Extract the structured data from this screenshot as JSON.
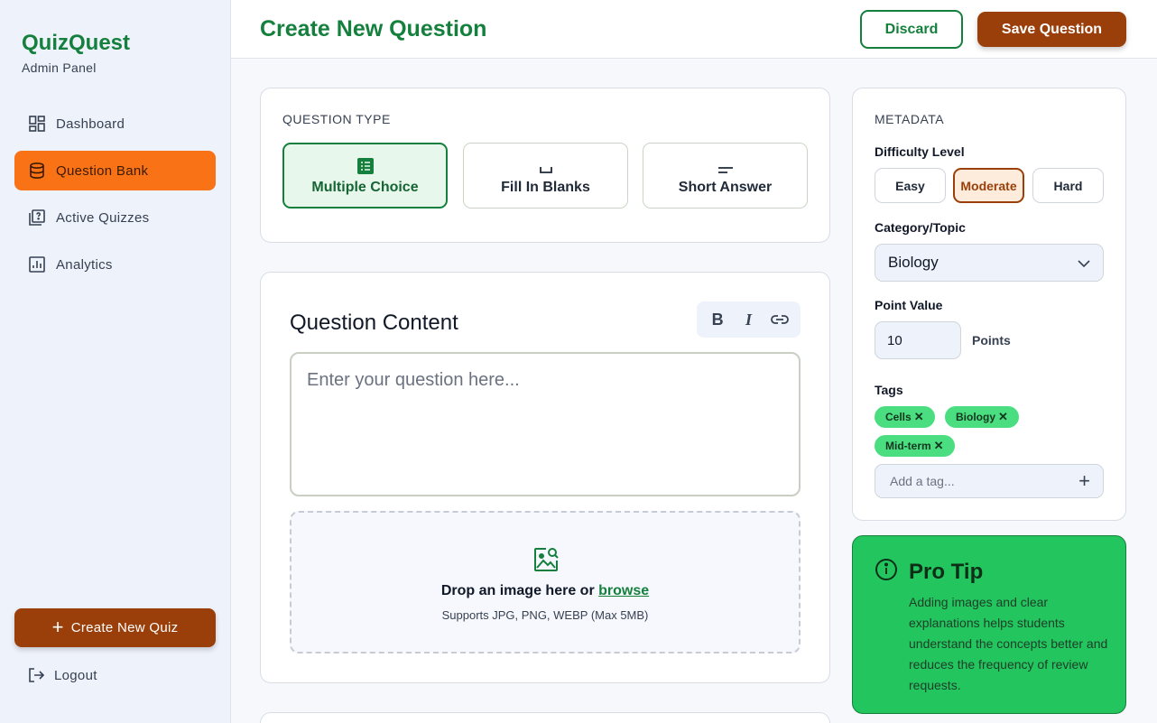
{
  "sidebar": {
    "brand": "QuizQuest",
    "subtitle": "Admin Panel",
    "items": [
      {
        "label": "Dashboard",
        "icon": "dashboard-grid-icon"
      },
      {
        "label": "Question Bank",
        "icon": "database-icon"
      },
      {
        "label": "Active Quizzes",
        "icon": "quiz-icon"
      },
      {
        "label": "Analytics",
        "icon": "bar-chart-icon"
      }
    ],
    "active_index": 1,
    "create_quiz_label": "Create New Quiz",
    "logout_label": "Logout"
  },
  "header": {
    "title": "Create New Question",
    "discard_label": "Discard",
    "save_label": "Save Question"
  },
  "question_type": {
    "section_label": "QUESTION TYPE",
    "options": [
      {
        "label": "Multiple Choice",
        "icon": "list-icon"
      },
      {
        "label": "Fill In Blanks",
        "icon": "blank-icon"
      },
      {
        "label": "Short Answer",
        "icon": "short-text-icon"
      }
    ],
    "selected": "Multiple Choice"
  },
  "content": {
    "title": "Question Content",
    "format": {
      "bold": "B",
      "italic": "I"
    },
    "placeholder": "Enter your question here...",
    "dropzone_text": "Drop an image here or",
    "dropzone_link": "browse",
    "dropzone_hint": "Supports JPG, PNG, WEBP (Max 5MB)"
  },
  "metadata": {
    "section_label": "METADATA",
    "difficulty_label": "Difficulty Level",
    "difficulty_options": [
      "Easy",
      "Moderate",
      "Hard"
    ],
    "difficulty_selected": "Moderate",
    "category_label": "Category/Topic",
    "category_value": "Biology",
    "points_label": "Point Value",
    "points_value": "10",
    "points_suffix": "Points",
    "tags_label": "Tags",
    "tags": [
      "Cells",
      "Biology",
      "Mid-term"
    ],
    "tag_placeholder": "Add a tag..."
  },
  "tip": {
    "title": "Pro Tip",
    "body": "Adding images and clear explanations helps students understand the concepts better and reduces the frequency of review requests."
  },
  "colors": {
    "primary_green": "#15803d",
    "accent_orange": "#f97316",
    "brown": "#9a3f0a",
    "tip_green": "#22c55e"
  }
}
